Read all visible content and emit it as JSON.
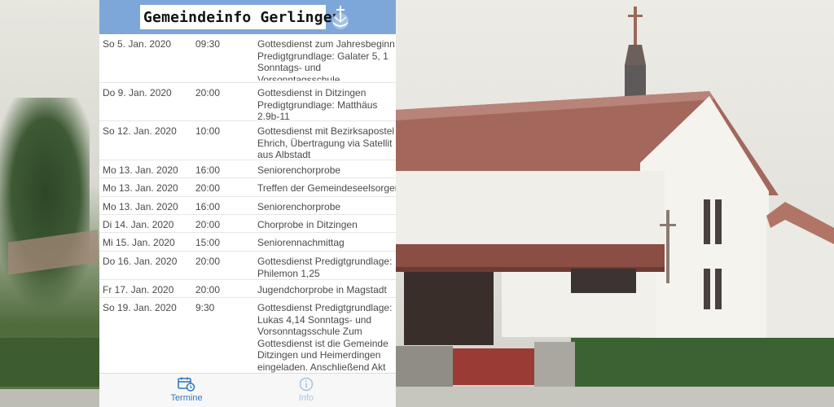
{
  "header": {
    "title": "Gemeindeinfo Gerlingen",
    "logo_icon": "church-emblem-icon",
    "background_color": "#7da7d8"
  },
  "appointments": [
    {
      "date": "So 5. Jan. 2020",
      "time": "09:30",
      "desc": "Gottesdienst zum Jahresbeginn Predigtgrundlage: Galater 5, 1 Sonntags- und Vorsonntagsschule"
    },
    {
      "date": "Do 9. Jan. 2020",
      "time": "20:00",
      "desc": "Gottesdienst in Ditzingen Predigtgrundlage: Matthäus 2,9b-11"
    },
    {
      "date": "So 12. Jan. 2020",
      "time": "10:00",
      "desc": "Gottesdienst mit Bezirksapostel Ehrich, Übertragung via Satellit aus Albstadt"
    },
    {
      "date": "Mo 13. Jan. 2020",
      "time": "16:00",
      "desc": "Seniorenchorprobe"
    },
    {
      "date": "Mo 13. Jan. 2020",
      "time": "20:00",
      "desc": "Treffen der Gemeindeseelsorger"
    },
    {
      "date": "Mo 13. Jan. 2020",
      "time": "16:00",
      "desc": "Seniorenchorprobe"
    },
    {
      "date": "Di 14. Jan. 2020",
      "time": "20:00",
      "desc": "Chorprobe in Ditzingen"
    },
    {
      "date": "Mi 15. Jan. 2020",
      "time": "15:00",
      "desc": "Seniorennachmittag"
    },
    {
      "date": "Do 16. Jan. 2020",
      "time": "20:00",
      "desc": "Gottesdienst Predigtgrundlage: Philemon 1,25"
    },
    {
      "date": "Fr 17. Jan. 2020",
      "time": "20:00",
      "desc": "Jugendchorprobe in Magstadt"
    },
    {
      "date": "So 19. Jan. 2020",
      "time": "9:30",
      "desc": "Gottesdienst Predigtgrundlage: Lukas 4,14 Sonntags- und Vorsonntagsschule Zum Gottesdienst ist die Gemeinde Ditzingen und Heimerdingen eingeladen. Anschließend Akt der Reli-Kids."
    }
  ],
  "tabbar": {
    "termine_label": "Termine",
    "termine_icon": "calendar-clock-icon",
    "info_label": "Info",
    "info_icon": "info-icon",
    "active_color": "#2d78c2",
    "inactive_color": "#a9c4e2"
  }
}
